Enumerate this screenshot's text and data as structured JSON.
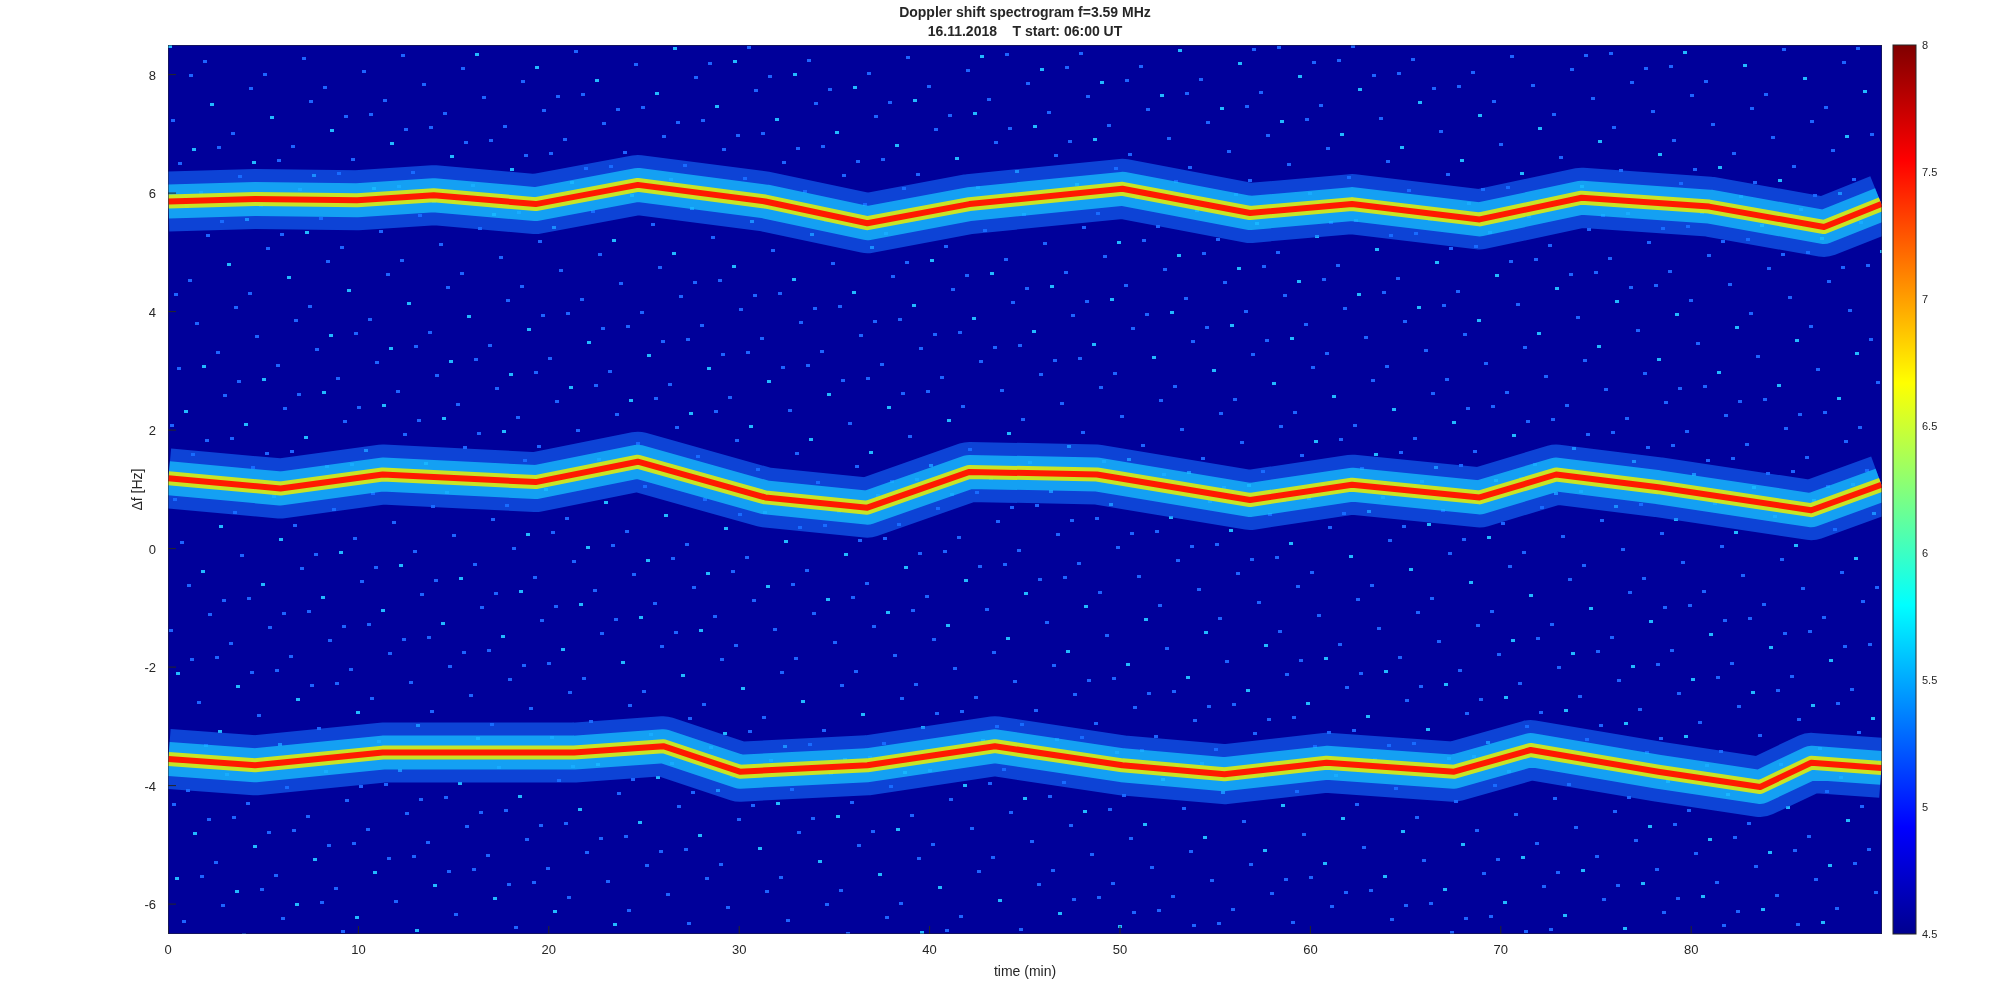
{
  "figure": {
    "title": "Doppler shift spectrogram f=3.59 MHz",
    "subtitle": "16.11.2018    T start: 06:00 UT",
    "xlabel": "time (min)",
    "ylabel": "Δf [Hz]",
    "xtick_labels": [
      "0",
      "10",
      "20",
      "30",
      "40",
      "50",
      "60",
      "70",
      "80"
    ],
    "ytick_labels": [
      "8",
      "6",
      "4",
      "2",
      "0",
      "-2",
      "-4",
      "-6"
    ],
    "colorbar_tick_labels": [
      "8",
      "7.5",
      "7",
      "6.5",
      "6",
      "5.5",
      "5",
      "4.5"
    ]
  }
}
